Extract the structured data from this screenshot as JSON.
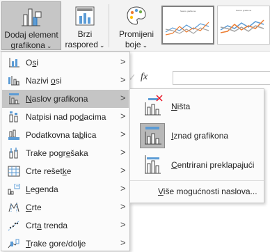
{
  "ribbon": {
    "add_element_line1": "Dodaj element",
    "add_element_line2": "grafikona",
    "quick_layout_line1": "Brzi",
    "quick_layout_line2": "raspored",
    "change_colors_line1": "Promijeni",
    "change_colors_line2": "boje",
    "gallery_title_1": "Naslov grafikona",
    "gallery_title_2": "Naslov grafikona"
  },
  "formula_bar": {
    "fx": "fx"
  },
  "menu": {
    "items": [
      {
        "pre": "O",
        "ul": "s",
        "post": "i",
        "icon": "axes-icon"
      },
      {
        "pre": "Nazivi ",
        "ul": "o",
        "post": "si",
        "icon": "axis-titles-icon"
      },
      {
        "pre": "",
        "ul": "N",
        "post": "aslov grafikona",
        "icon": "chart-title-icon"
      },
      {
        "pre": "Natpisi nad po",
        "ul": "d",
        "post": "acima",
        "icon": "data-labels-icon"
      },
      {
        "pre": "Podatkovna ta",
        "ul": "b",
        "post": "lica",
        "icon": "data-table-icon"
      },
      {
        "pre": "Trake pogr",
        "ul": "e",
        "post": "šaka",
        "icon": "error-bars-icon"
      },
      {
        "pre": "Crte rešet",
        "ul": "k",
        "post": "e",
        "icon": "gridlines-icon"
      },
      {
        "pre": "",
        "ul": "L",
        "post": "egenda",
        "icon": "legend-icon"
      },
      {
        "pre": "",
        "ul": "C",
        "post": "rte",
        "icon": "lines-icon"
      },
      {
        "pre": "Crt",
        "ul": "a",
        "post": " trenda",
        "icon": "trendline-icon"
      },
      {
        "pre": "",
        "ul": "T",
        "post": "rake gore/dolje",
        "icon": "up-down-bars-icon"
      }
    ],
    "arrow": ">"
  },
  "submenu": {
    "options": [
      {
        "pre": "",
        "ul": "N",
        "post": "išta",
        "icon": "no-title-icon"
      },
      {
        "pre": "",
        "ul": "I",
        "post": "znad grafikona",
        "icon": "above-chart-icon"
      },
      {
        "pre": "",
        "ul": "C",
        "post": "entrirani preklapajući",
        "icon": "centered-overlay-icon"
      }
    ],
    "more": {
      "pre": "",
      "ul": "V",
      "post": "iše mogućnosti naslova..."
    }
  }
}
